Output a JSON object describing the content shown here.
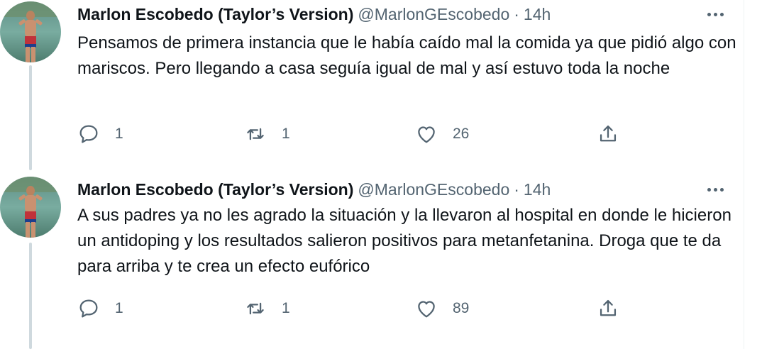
{
  "colors": {
    "text_primary": "#0f1419",
    "text_secondary": "#536471",
    "thread_line": "#cfd9de",
    "background": "#ffffff"
  },
  "icons": {
    "reply": "speech-bubble-icon",
    "retweet": "retweet-arrows-icon",
    "like": "heart-outline-icon",
    "share": "share-upload-icon",
    "more": "three-dots-icon"
  },
  "tweets": [
    {
      "author": {
        "name": "Marlon Escobedo (Taylor’s Version)",
        "handle": "@MarlonGEscobedo"
      },
      "separator": "·",
      "time": "14h",
      "text": "Pensamos de primera instancia que le había caído mal la comida ya que pidió algo con mariscos. Pero llegando a casa seguía igual de mal y así estuvo toda la noche",
      "replies": "1",
      "retweets": "1",
      "likes": "26"
    },
    {
      "author": {
        "name": "Marlon Escobedo (Taylor’s Version)",
        "handle": "@MarlonGEscobedo"
      },
      "separator": "·",
      "time": "14h",
      "text": "A sus padres ya no les agrado la situación y la llevaron al hospital en donde le hicieron un antidoping  y los resultados salieron positivos para metanfetanina. Droga que te da para arriba y te crea un efecto eufórico",
      "replies": "1",
      "retweets": "1",
      "likes": "89"
    }
  ]
}
